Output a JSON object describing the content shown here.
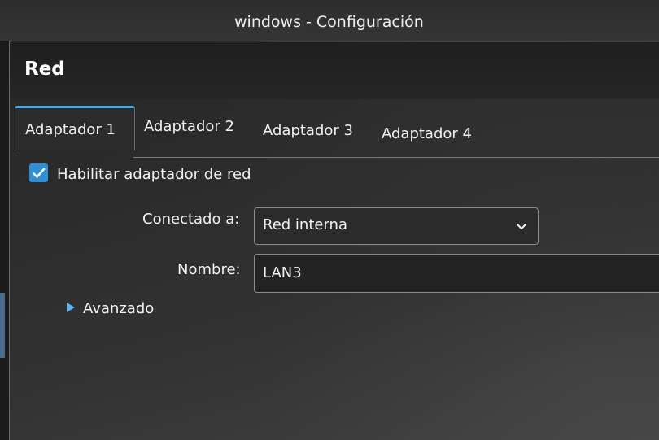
{
  "window": {
    "title": "windows - Configuración"
  },
  "section": {
    "title": "Red"
  },
  "tabs": [
    {
      "label": "Adaptador 1",
      "active": true
    },
    {
      "label": "Adaptador 2",
      "active": false
    },
    {
      "label": "Adaptador 3",
      "active": false
    },
    {
      "label": "Adaptador 4",
      "active": false
    }
  ],
  "adapter": {
    "enable_label": "Habilitar adaptador de red",
    "enabled": true,
    "attached_label": "Conectado a:",
    "attached_value": "Red interna",
    "name_label": "Nombre:",
    "name_value": "LAN3",
    "advanced_label": "Avanzado"
  },
  "icons": {
    "checkbox": "checkmark-icon",
    "dropdown": "chevron-down-icon",
    "expander": "triangle-right-icon"
  },
  "colors": {
    "accent": "#2e8fd6",
    "tab_accent": "#46a7e0"
  }
}
